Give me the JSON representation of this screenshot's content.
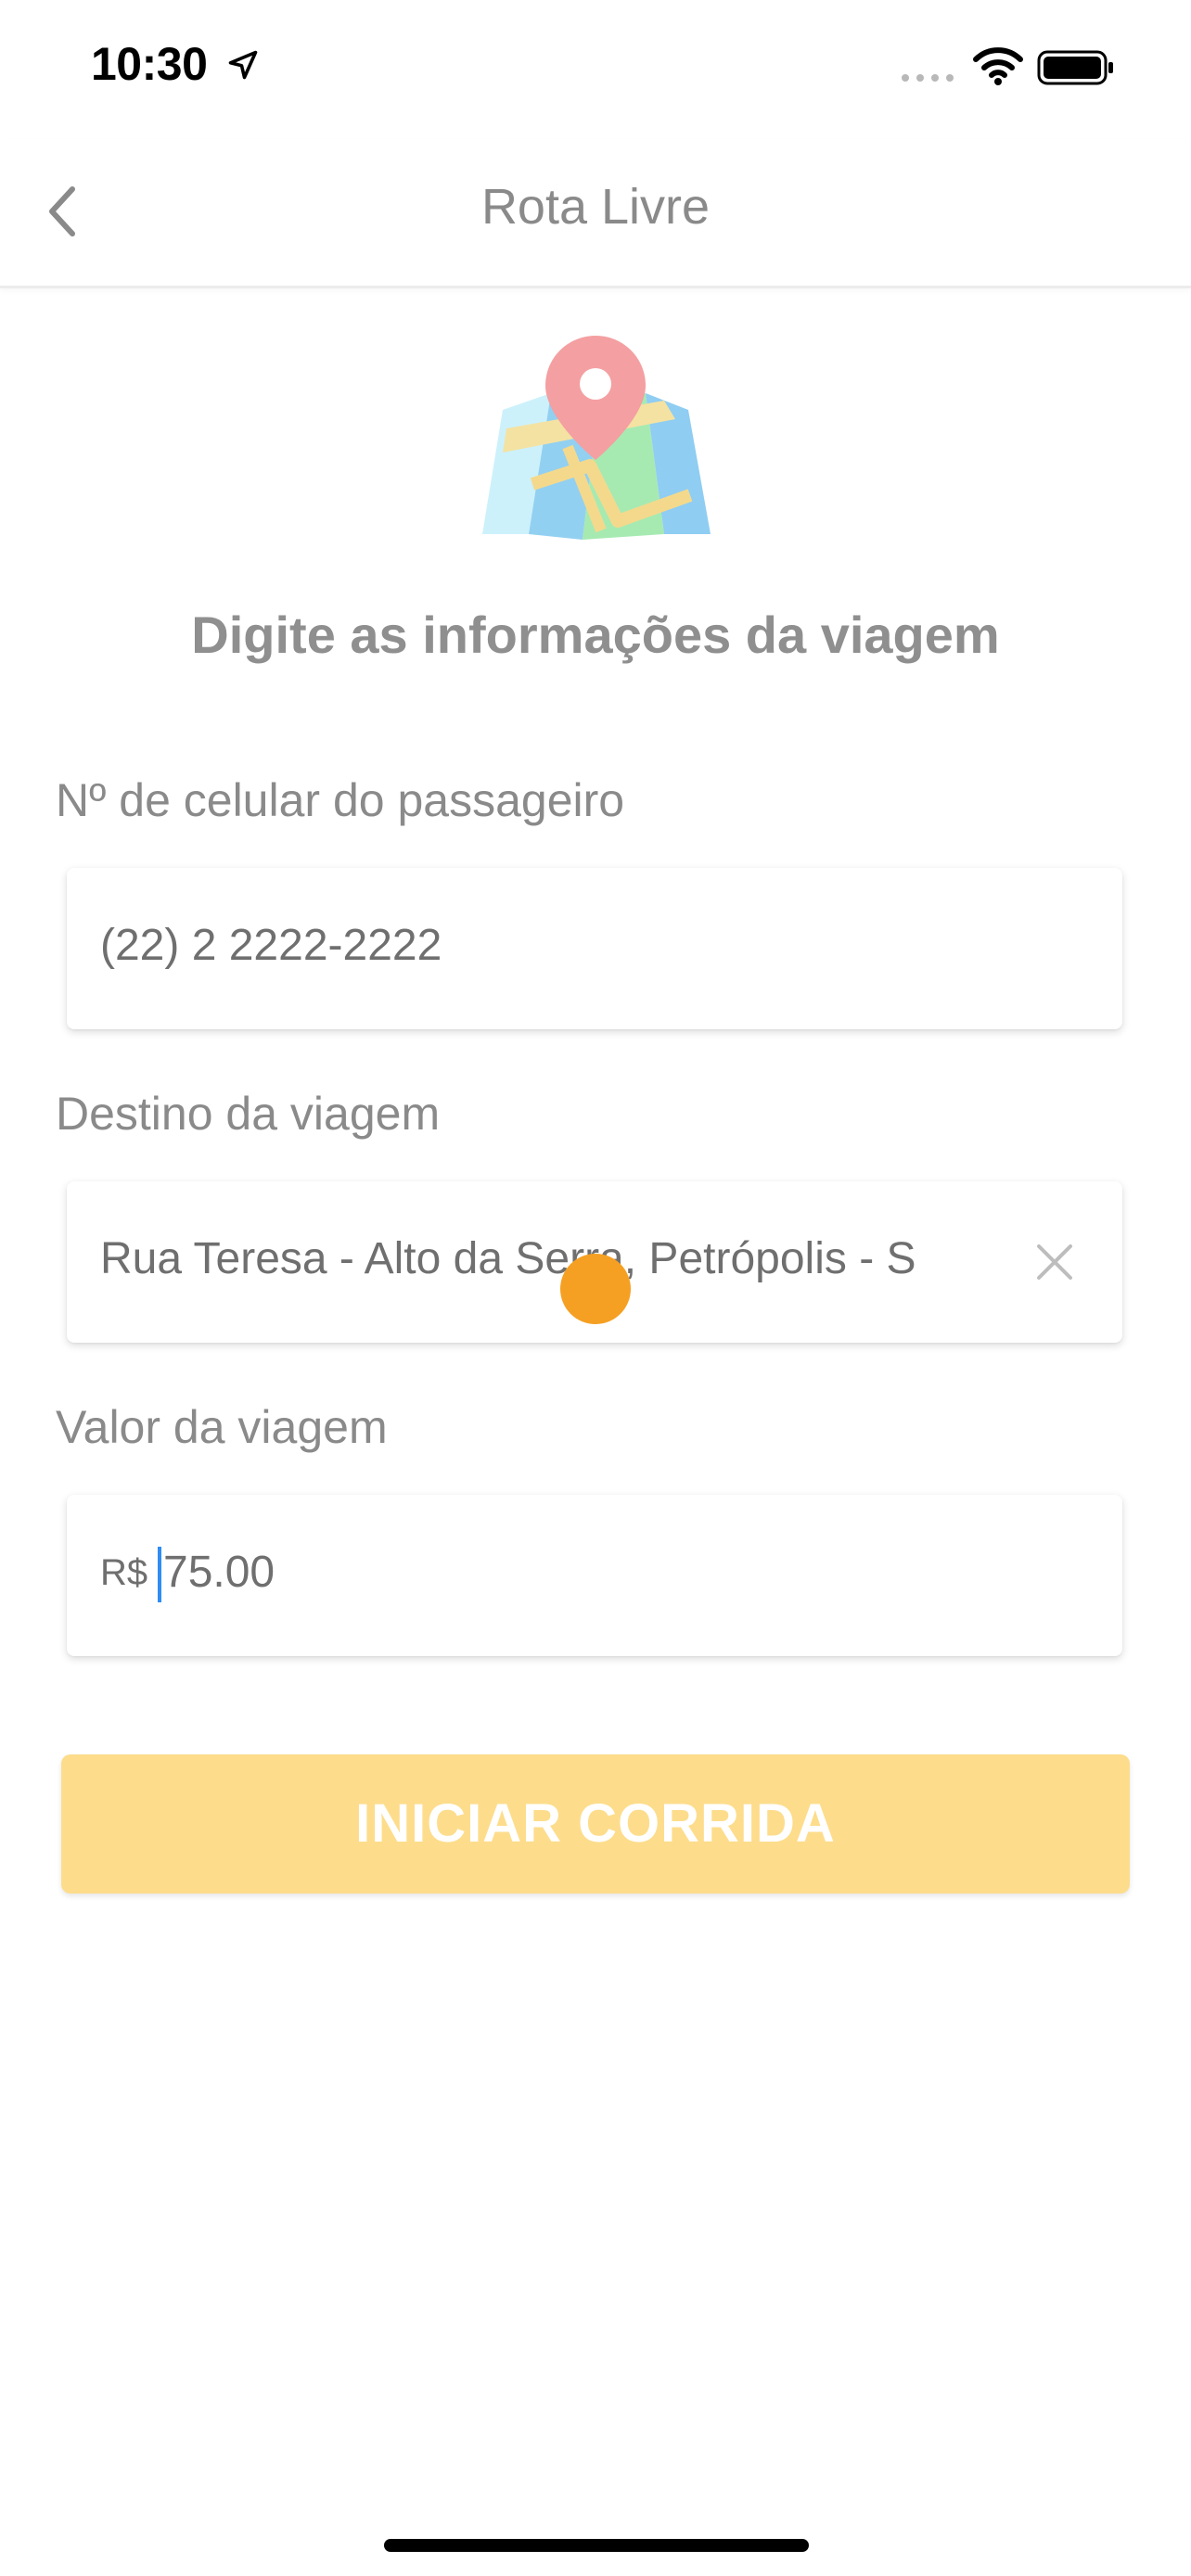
{
  "status_bar": {
    "time": "10:30",
    "icons": [
      "location-arrow-icon",
      "cellular-signal-icon",
      "wifi-icon",
      "battery-icon"
    ]
  },
  "navbar": {
    "title": "Rota Livre",
    "back_icon": "chevron-left-icon"
  },
  "illustration": "map-pin-icon",
  "headline": "Digite as informações da viagem",
  "form": {
    "phone": {
      "label": "Nº de celular do passageiro",
      "value": "(22) 2 2222-2222"
    },
    "destination": {
      "label": "Destino da viagem",
      "value": "Rua Teresa - Alto da Serra, Petrópolis - S",
      "clear_icon": "close-icon"
    },
    "fare": {
      "label": "Valor da viagem",
      "prefix": "R$",
      "value": "75.00"
    }
  },
  "start_button": {
    "label": "INICIAR CORRIDA"
  },
  "colors": {
    "accent_button": "#fddd8c",
    "touch_indicator": "#f5a023",
    "caret": "#2f8df5",
    "text_muted": "#8a8a8a"
  }
}
